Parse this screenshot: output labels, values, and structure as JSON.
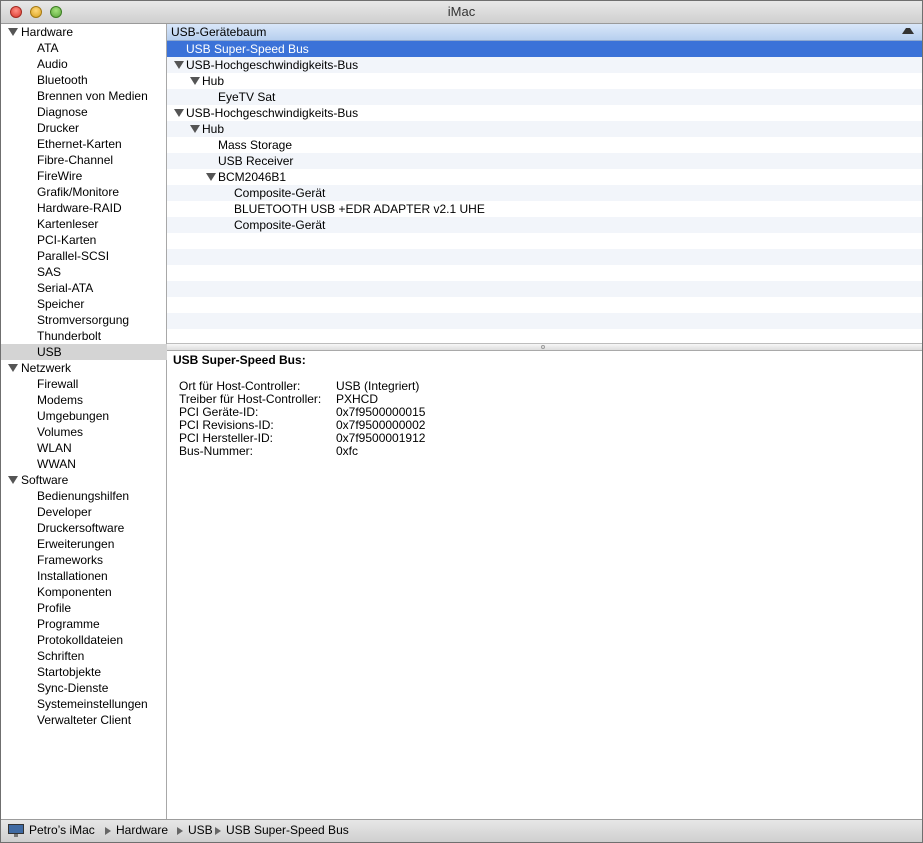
{
  "window": {
    "title": "iMac"
  },
  "sidebar": {
    "groups": [
      {
        "label": "Hardware",
        "items": [
          "ATA",
          "Audio",
          "Bluetooth",
          "Brennen von Medien",
          "Diagnose",
          "Drucker",
          "Ethernet-Karten",
          "Fibre-Channel",
          "FireWire",
          "Grafik/Monitore",
          "Hardware-RAID",
          "Kartenleser",
          "PCI-Karten",
          "Parallel-SCSI",
          "SAS",
          "Serial-ATA",
          "Speicher",
          "Stromversorgung",
          "Thunderbolt",
          "USB"
        ]
      },
      {
        "label": "Netzwerk",
        "items": [
          "Firewall",
          "Modems",
          "Umgebungen",
          "Volumes",
          "WLAN",
          "WWAN"
        ]
      },
      {
        "label": "Software",
        "items": [
          "Bedienungshilfen",
          "Developer",
          "Druckersoftware",
          "Erweiterungen",
          "Frameworks",
          "Installationen",
          "Komponenten",
          "Profile",
          "Programme",
          "Protokolldateien",
          "Schriften",
          "Startobjekte",
          "Sync-Dienste",
          "Systemeinstellungen",
          "Verwalteter Client"
        ]
      }
    ],
    "selected": "USB"
  },
  "tree": {
    "header": "USB-Gerätebaum",
    "rows": [
      {
        "label": "USB Super-Speed Bus",
        "level": 0,
        "expandable": false,
        "selected": true
      },
      {
        "label": "USB-Hochgeschwindigkeits-Bus",
        "level": 0,
        "expandable": true
      },
      {
        "label": "Hub",
        "level": 1,
        "expandable": true
      },
      {
        "label": "EyeTV Sat",
        "level": 2,
        "expandable": false
      },
      {
        "label": "USB-Hochgeschwindigkeits-Bus",
        "level": 0,
        "expandable": true
      },
      {
        "label": "Hub",
        "level": 1,
        "expandable": true
      },
      {
        "label": "Mass Storage",
        "level": 2,
        "expandable": false
      },
      {
        "label": "USB Receiver",
        "level": 2,
        "expandable": false
      },
      {
        "label": "BCM2046B1",
        "level": 2,
        "expandable": true
      },
      {
        "label": "Composite-Gerät",
        "level": 3,
        "expandable": false
      },
      {
        "label": "BLUETOOTH USB +EDR ADAPTER v2.1 UHE",
        "level": 3,
        "expandable": false
      },
      {
        "label": "Composite-Gerät",
        "level": 3,
        "expandable": false
      }
    ]
  },
  "detail": {
    "title": "USB Super-Speed Bus:",
    "fields": [
      {
        "key": "Ort für Host-Controller:",
        "value": "USB (Integriert)"
      },
      {
        "key": "Treiber für Host-Controller:",
        "value": "PXHCD"
      },
      {
        "key": "PCI Geräte-ID:",
        "value": "0x7f9500000015"
      },
      {
        "key": "PCI Revisions-ID:",
        "value": "0x7f9500000002"
      },
      {
        "key": "PCI Hersteller-ID:",
        "value": "0x7f9500001912"
      },
      {
        "key": "Bus-Nummer:",
        "value": "0xfc"
      }
    ]
  },
  "pathbar": {
    "segments": [
      "Petro’s iMac",
      "Hardware",
      "USB",
      "USB Super-Speed Bus"
    ],
    "icon": "imac-icon"
  },
  "colors": {
    "selection": "#3b72d8",
    "sidebar_selection": "#d4d4d4",
    "header_blue": "#c8dbf4",
    "stripe": "#f2f5fa"
  }
}
